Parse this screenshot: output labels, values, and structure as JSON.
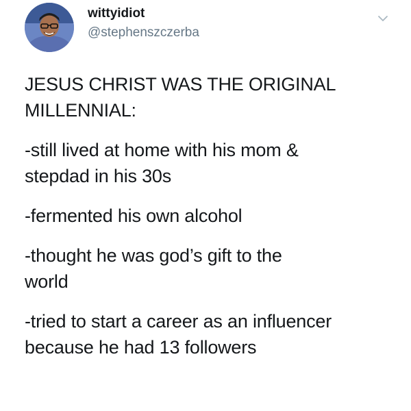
{
  "tweet": {
    "display_name": "wittyidiot",
    "handle": "@stephenszczerba",
    "avatar_icon": "profile-photo-avatar",
    "menu_icon": "chevron-down-icon",
    "paragraphs": [
      [
        "JESUS CHRIST WAS THE ORIGINAL",
        "MILLENNIAL:"
      ],
      [
        "-still lived at home with his mom &",
        "stepdad in his 30s"
      ],
      [
        "-fermented his own alcohol"
      ],
      [
        "-thought he was god’s gift to the",
        "world"
      ],
      [
        "-tried to start a career as an influencer",
        "because he had 13 followers"
      ]
    ]
  },
  "colors": {
    "text": "#14171a",
    "secondary": "#657786",
    "chevron": "#aab8c2",
    "avatar_bg": "#5f79b8"
  }
}
